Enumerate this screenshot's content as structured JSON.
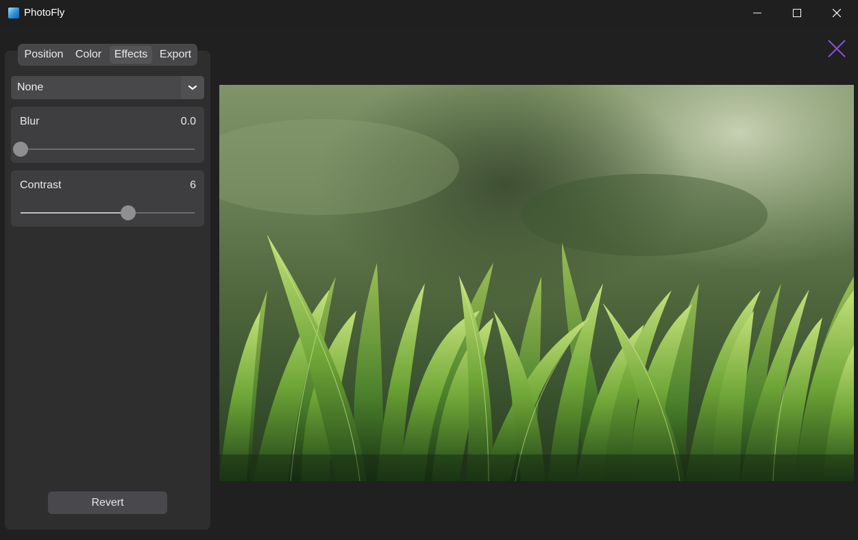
{
  "window": {
    "title": "PhotoFly",
    "controls": [
      "minimize-icon",
      "maximize-icon",
      "close-icon"
    ]
  },
  "tabs": [
    {
      "label": "Position",
      "selected": false
    },
    {
      "label": "Color",
      "selected": false
    },
    {
      "label": "Effects",
      "selected": true
    },
    {
      "label": "Export",
      "selected": false
    }
  ],
  "effect_select": {
    "value": "None"
  },
  "sliders": {
    "blur": {
      "label": "Blur",
      "value": "0.0",
      "fraction": 0.0
    },
    "contrast": {
      "label": "Contrast",
      "value": "6",
      "fraction": 0.62
    }
  },
  "revert": {
    "label": "Revert"
  },
  "colors": {
    "accent_close": "#8a4fe0",
    "panel": "#2e2e2f",
    "background": "#202020"
  },
  "image": {
    "subject": "photo-grass"
  }
}
